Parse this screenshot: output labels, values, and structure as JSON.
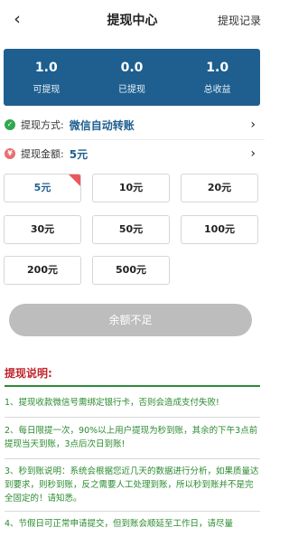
{
  "header": {
    "back_icon": "chevron-left-icon",
    "title": "提现中心",
    "record_link": "提现记录"
  },
  "stats": [
    {
      "value": "1.0",
      "label": "可提现"
    },
    {
      "value": "0.0",
      "label": "已提现"
    },
    {
      "value": "1.0",
      "label": "总收益"
    }
  ],
  "method": {
    "icon": "check-circle-icon",
    "label": "提现方式:",
    "value": "微信自动转账"
  },
  "amount_row": {
    "icon": "yen-circle-icon",
    "label": "提现金额:",
    "value": "5元"
  },
  "amounts": [
    "5元",
    "10元",
    "20元",
    "30元",
    "50元",
    "100元",
    "200元",
    "500元"
  ],
  "selected_amount": "5元",
  "button": {
    "label": "余额不足"
  },
  "notes_title": "提现说明:",
  "notes": [
    "1、提现收款微信号需绑定银行卡，否则会造成支付失败!",
    "2、每日限提一次，90%以上用户提现为秒到账，其余的下午3点前提现当天到账，3点后次日到账!",
    "3、秒到账说明：系统会根据您近几天的数据进行分析，如果质量达到要求，则秒到账，反之需要人工处理到账，所以秒到账并不是完全固定的！请知悉。",
    "4、节假日可正常申请提交，但到账会顺延至工作日，请尽量"
  ],
  "colors": {
    "brand_blue": "#1e5f8f",
    "note_green": "#2a8a2e",
    "title_red": "#c0262d",
    "disabled_gray": "#bdbdbd"
  }
}
